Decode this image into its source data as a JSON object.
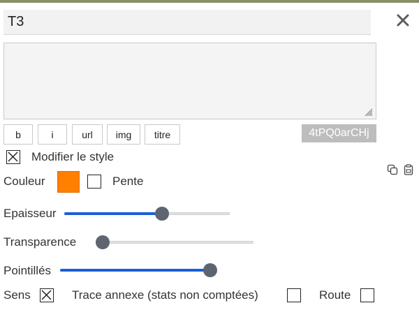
{
  "header": {
    "title_value": "T3",
    "close_icon": "close-icon"
  },
  "description": {
    "value": ""
  },
  "format_buttons": [
    {
      "label": "b"
    },
    {
      "label": "i"
    },
    {
      "label": "url"
    },
    {
      "label": "img"
    },
    {
      "label": "titre"
    }
  ],
  "code_badge": "4tPQ0arCHj",
  "style": {
    "modify_label": "Modifier le style",
    "modify_checked": true,
    "couleur_label": "Couleur",
    "color": "#ff7f00",
    "pente_label": "Pente",
    "pente_checked": false
  },
  "side_icons": [
    "copy-icon",
    "clipboard-icon"
  ],
  "sliders": {
    "epaisseur": {
      "label": "Epaisseur",
      "value": 0.6
    },
    "transparence": {
      "label": "Transparence",
      "value": 0.0
    },
    "pointilles": {
      "label": "Pointillés",
      "value": 1.0
    }
  },
  "options": {
    "sens_label": "Sens",
    "sens_checked": true,
    "trace_label": "Trace annexe (stats non comptées)",
    "trace_checked": false,
    "route_label": "Route",
    "route_checked": false
  },
  "colors": {
    "accent": "#1b5fd8",
    "thumb": "#5e6470",
    "swatch": "#ff7f00"
  }
}
